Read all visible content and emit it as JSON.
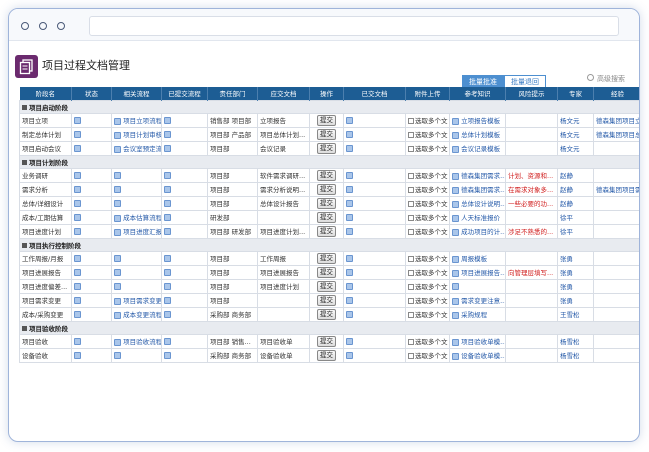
{
  "app": {
    "title": "项目过程文档管理",
    "icon": "document-stack-icon"
  },
  "toolbar": {
    "batch_approve": "批量批准",
    "batch_return": "批量退回",
    "search": "高级搜索"
  },
  "columns": [
    "阶段名",
    "状态",
    "相关流程",
    "已提交流程",
    "责任部门",
    "应交文档",
    "操作",
    "已交文档",
    "附件上传",
    "参考知识",
    "风险提示",
    "专家",
    "经验"
  ],
  "labels": {
    "submit": "提交",
    "select": "选取多个文"
  },
  "colors": {
    "header": "#1d5d94",
    "accent": "#4d8fd0",
    "app_icon": "#6b2a6e",
    "risk": "#d12020",
    "link": "#2459a8"
  },
  "sections": [
    {
      "phase": "项目启动阶段",
      "rows": [
        {
          "name": "项目立项",
          "flow": "项目立项流程",
          "dept": "销售部 项目部",
          "doc": "立项报告",
          "know": "立项报告模板",
          "risk": "",
          "expert": "杨文元",
          "exp": "德森集团项目立项"
        },
        {
          "name": "制定总体计划",
          "flow": "项目计划审核...",
          "dept": "项目部 产品部",
          "doc": "项目总体计划...",
          "know": "总体计划模板",
          "risk": "",
          "expert": "杨文元",
          "exp": "德森集团项目总体计"
        },
        {
          "name": "项目启动会议",
          "flow": "会议室预定流...",
          "dept": "项目部",
          "doc": "会议记录",
          "know": "会议记录模板",
          "risk": "",
          "expert": "杨文元",
          "exp": ""
        }
      ]
    },
    {
      "phase": "项目计划阶段",
      "rows": [
        {
          "name": "业务调研",
          "flow": "",
          "dept": "项目部",
          "doc": "软件需求调研...",
          "know": "德森集团需求...",
          "risk": "计划、资源和...",
          "expert": "赵静",
          "exp": ""
        },
        {
          "name": "需求分析",
          "flow": "",
          "dept": "项目部",
          "doc": "需求分析说明...",
          "know": "德森集团需求...",
          "risk": "在需求对象多...",
          "expert": "赵静",
          "exp": "德森集团项目需求分"
        },
        {
          "name": "总体/详细设计",
          "flow": "",
          "dept": "项目部",
          "doc": "总体设计报告",
          "know": "总体设计说明...",
          "risk": "一些必要的功...",
          "expert": "赵静",
          "exp": ""
        },
        {
          "name": "成本/工期估算",
          "flow": "成本估算流程",
          "dept": "研发部",
          "doc": "",
          "know": "人天标准报价",
          "risk": "",
          "expert": "徐平",
          "exp": ""
        },
        {
          "name": "项目进度计划",
          "flow": "项目进度汇报...",
          "dept": "项目部 研发部",
          "doc": "项目进度计划...",
          "know": "成功项目的计...",
          "risk": "涉足不熟悉的...",
          "expert": "徐平",
          "exp": ""
        }
      ]
    },
    {
      "phase": "项目执行控制阶段",
      "rows": [
        {
          "name": "工作周报/月报",
          "flow": "",
          "dept": "项目部",
          "doc": "工作周报",
          "know": "周报模板",
          "risk": "",
          "expert": "张勇",
          "exp": ""
        },
        {
          "name": "项目进展报告",
          "flow": "",
          "dept": "项目部",
          "doc": "项目进展报告",
          "know": "项目进展报告...",
          "risk": "向管理层填写...",
          "expert": "张勇",
          "exp": ""
        },
        {
          "name": "项目进度偏差...",
          "flow": "",
          "dept": "项目部",
          "doc": "项目进度计划",
          "know": "",
          "risk": "",
          "expert": "张勇",
          "exp": ""
        },
        {
          "name": "项目需求变更",
          "flow": "项目需求变更...",
          "dept": "项目部",
          "doc": "",
          "know": "需求变更注意...",
          "risk": "",
          "expert": "张勇",
          "exp": ""
        },
        {
          "name": "成本/采购变更",
          "flow": "成本变更流程",
          "dept": "采购部 商务部",
          "doc": "",
          "know": "采购规程",
          "risk": "",
          "expert": "王雪松",
          "exp": ""
        }
      ]
    },
    {
      "phase": "项目验收阶段",
      "rows": [
        {
          "name": "项目验收",
          "flow": "项目验收流程",
          "dept": "项目部 销售...",
          "doc": "项目验收单",
          "know": "项目验收单模...",
          "risk": "",
          "expert": "杨雪松",
          "exp": ""
        },
        {
          "name": "设备验收",
          "flow": "",
          "dept": "采购部 商务部",
          "doc": "设备验收单",
          "know": "设备验收单模...",
          "risk": "",
          "expert": "杨雪松",
          "exp": ""
        }
      ]
    }
  ]
}
